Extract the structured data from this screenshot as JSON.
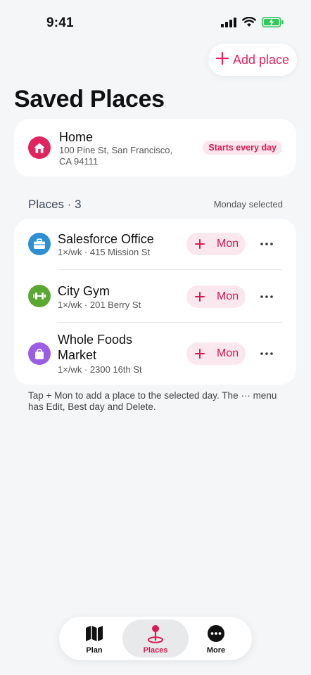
{
  "status_bar": {
    "time": "9:41"
  },
  "header": {
    "add_place_label": "Add place",
    "title": "Saved Places"
  },
  "home": {
    "name": "Home",
    "address": "100 Pine St, San Francisco, CA 94111",
    "badge": "Starts every day",
    "icon": "house-icon"
  },
  "places_section": {
    "title": "Places · 3",
    "selected_day_text": "Monday selected",
    "items": [
      {
        "name": "Salesforce Office",
        "meta": "1×/wk · 415 Mission St",
        "icon": "briefcase-icon",
        "icon_color": "#2d8fd5",
        "day_button": "Mon"
      },
      {
        "name": "City Gym",
        "meta": "1×/wk · 201 Berry St",
        "icon": "dumbbell-icon",
        "icon_color": "#5aa832",
        "day_button": "Mon"
      },
      {
        "name": "Whole Foods Market",
        "meta": "1×/wk · 2300 16th St",
        "icon": "shopping-bag-icon",
        "icon_color": "#9b5de5",
        "day_button": "Mon"
      }
    ]
  },
  "help_text": "Tap + Mon to add a place to the selected day. The ··· menu has Edit, Best day and Delete.",
  "tab_bar": {
    "tabs": [
      {
        "label": "Plan",
        "icon": "map-icon",
        "active": false
      },
      {
        "label": "Places",
        "icon": "location-pin-icon",
        "active": true
      },
      {
        "label": "More",
        "icon": "more-icon",
        "active": false
      }
    ]
  },
  "colors": {
    "accent": "#e0245e",
    "background": "#f4f6f8",
    "badge_bg": "#fde6ee"
  }
}
